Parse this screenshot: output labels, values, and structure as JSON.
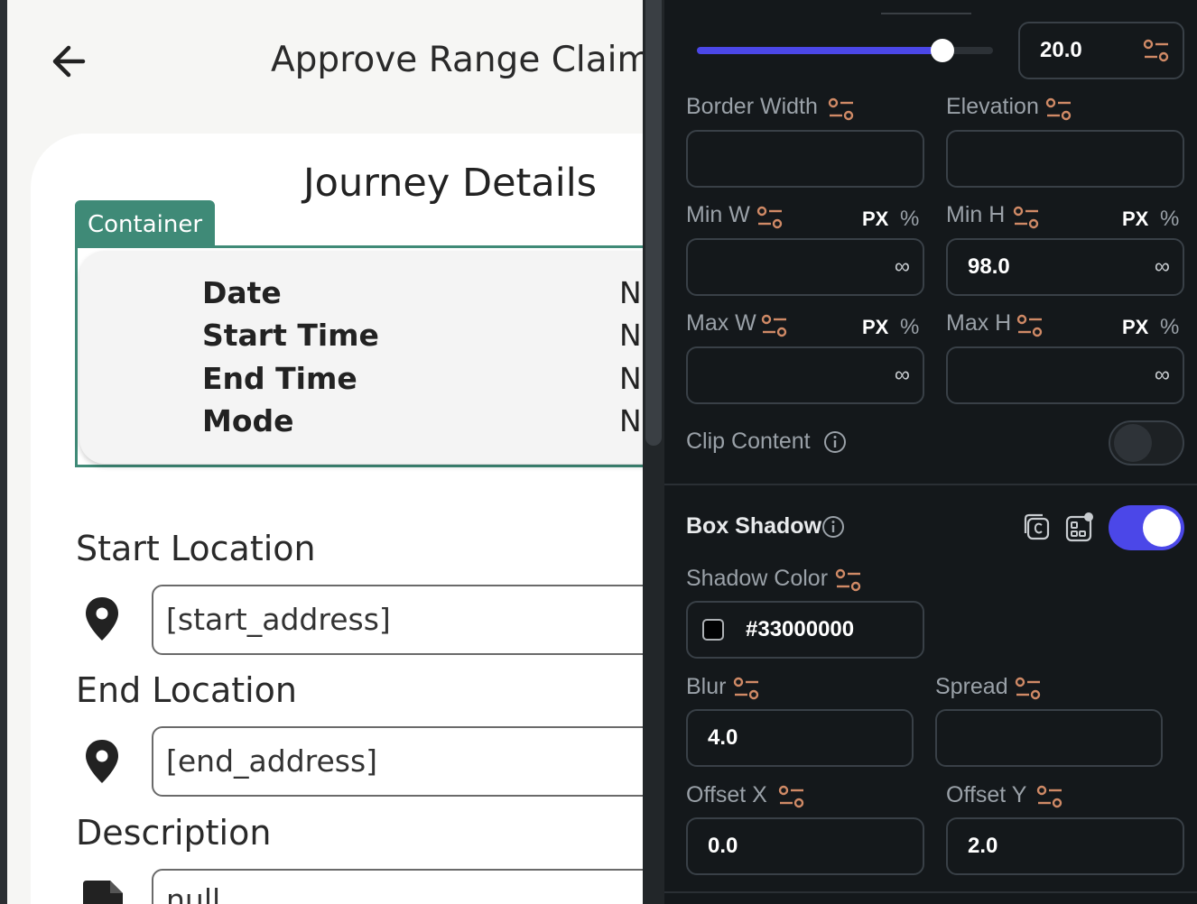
{
  "preview": {
    "app_title": "Approve Range Claim",
    "card_title": "Journey Details",
    "container_tag": "Container",
    "details": [
      {
        "label": "Date",
        "value": "N"
      },
      {
        "label": "Start Time",
        "value": "N"
      },
      {
        "label": "End Time",
        "value": "N"
      },
      {
        "label": "Mode",
        "value": "N"
      }
    ],
    "start_location_label": "Start Location",
    "start_address": "[start_address]",
    "end_location_label": "End Location",
    "end_address": "[end_address]",
    "description_label": "Description",
    "description_value": "null",
    "icons": {
      "back": "arrow-left-icon",
      "location": "map-pin-icon",
      "description": "file-icon"
    }
  },
  "panel": {
    "slider": {
      "value_label": "20.0",
      "fill_fraction": 0.83
    },
    "border_width": {
      "label": "Border Width",
      "value": ""
    },
    "elevation": {
      "label": "Elevation",
      "value": ""
    },
    "min_w": {
      "label": "Min W",
      "unit_px": "PX",
      "unit_pct": "%",
      "value": "",
      "infinity": "∞"
    },
    "min_h": {
      "label": "Min H",
      "unit_px": "PX",
      "unit_pct": "%",
      "value": "98.0",
      "infinity": "∞"
    },
    "max_w": {
      "label": "Max W",
      "unit_px": "PX",
      "unit_pct": "%",
      "value": "",
      "infinity": "∞"
    },
    "max_h": {
      "label": "Max H",
      "unit_px": "PX",
      "unit_pct": "%",
      "value": "",
      "infinity": "∞"
    },
    "clip_content": {
      "label": "Clip Content",
      "enabled": false
    },
    "box_shadow": {
      "label": "Box Shadow",
      "enabled": true
    },
    "shadow_color": {
      "label": "Shadow Color",
      "value": "#33000000"
    },
    "blur": {
      "label": "Blur",
      "value": "4.0"
    },
    "spread": {
      "label": "Spread",
      "value": ""
    },
    "offset_x": {
      "label": "Offset X",
      "value": "0.0"
    },
    "offset_y": {
      "label": "Offset Y",
      "value": "2.0"
    }
  },
  "colors": {
    "accent": "#4b47e8",
    "container_tag": "#3f8a77",
    "tune_icon": "#d08a66",
    "panel_bg": "#14181b"
  }
}
